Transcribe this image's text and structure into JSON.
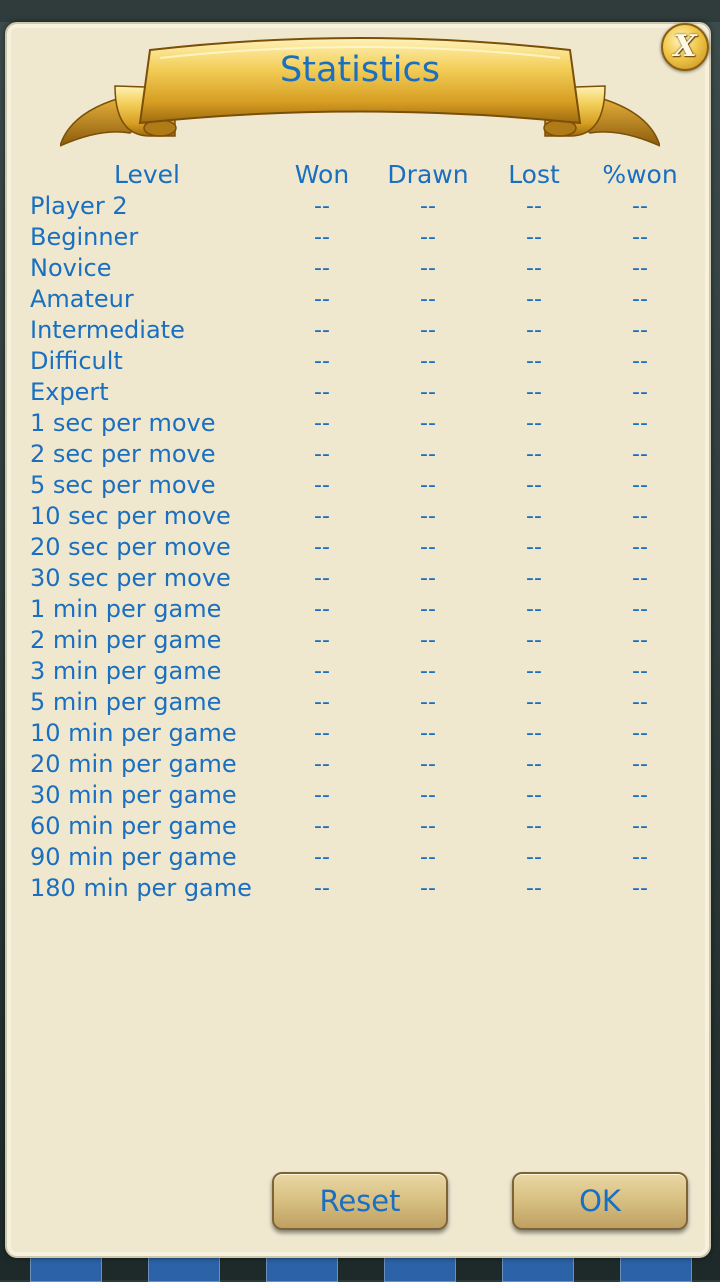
{
  "dialog": {
    "title": "Statistics",
    "close_label": "X"
  },
  "table": {
    "headers": {
      "level": "Level",
      "won": "Won",
      "drawn": "Drawn",
      "lost": "Lost",
      "pct_won": "%won"
    },
    "rows": [
      {
        "level": "Player 2",
        "won": "--",
        "drawn": "--",
        "lost": "--",
        "pct": "--"
      },
      {
        "level": "Beginner",
        "won": "--",
        "drawn": "--",
        "lost": "--",
        "pct": "--"
      },
      {
        "level": "Novice",
        "won": "--",
        "drawn": "--",
        "lost": "--",
        "pct": "--"
      },
      {
        "level": "Amateur",
        "won": "--",
        "drawn": "--",
        "lost": "--",
        "pct": "--"
      },
      {
        "level": "Intermediate",
        "won": "--",
        "drawn": "--",
        "lost": "--",
        "pct": "--"
      },
      {
        "level": "Difficult",
        "won": "--",
        "drawn": "--",
        "lost": "--",
        "pct": "--"
      },
      {
        "level": "Expert",
        "won": "--",
        "drawn": "--",
        "lost": "--",
        "pct": "--"
      },
      {
        "level": "1 sec per move",
        "won": "--",
        "drawn": "--",
        "lost": "--",
        "pct": "--"
      },
      {
        "level": "2 sec per move",
        "won": "--",
        "drawn": "--",
        "lost": "--",
        "pct": "--"
      },
      {
        "level": "5 sec per move",
        "won": "--",
        "drawn": "--",
        "lost": "--",
        "pct": "--"
      },
      {
        "level": "10 sec per move",
        "won": "--",
        "drawn": "--",
        "lost": "--",
        "pct": "--"
      },
      {
        "level": "20 sec per move",
        "won": "--",
        "drawn": "--",
        "lost": "--",
        "pct": "--"
      },
      {
        "level": "30 sec per move",
        "won": "--",
        "drawn": "--",
        "lost": "--",
        "pct": "--"
      },
      {
        "level": "1 min per game",
        "won": "--",
        "drawn": "--",
        "lost": "--",
        "pct": "--"
      },
      {
        "level": "2 min per game",
        "won": "--",
        "drawn": "--",
        "lost": "--",
        "pct": "--"
      },
      {
        "level": "3 min per game",
        "won": "--",
        "drawn": "--",
        "lost": "--",
        "pct": "--"
      },
      {
        "level": "5 min per game",
        "won": "--",
        "drawn": "--",
        "lost": "--",
        "pct": "--"
      },
      {
        "level": "10 min per game",
        "won": "--",
        "drawn": "--",
        "lost": "--",
        "pct": "--"
      },
      {
        "level": "20 min per game",
        "won": "--",
        "drawn": "--",
        "lost": "--",
        "pct": "--"
      },
      {
        "level": "30 min per game",
        "won": "--",
        "drawn": "--",
        "lost": "--",
        "pct": "--"
      },
      {
        "level": "60 min per game",
        "won": "--",
        "drawn": "--",
        "lost": "--",
        "pct": "--"
      },
      {
        "level": "90 min per game",
        "won": "--",
        "drawn": "--",
        "lost": "--",
        "pct": "--"
      },
      {
        "level": "180 min per game",
        "won": "--",
        "drawn": "--",
        "lost": "--",
        "pct": "--"
      }
    ]
  },
  "buttons": {
    "reset": "Reset",
    "ok": "OK"
  },
  "colors": {
    "text": "#1a6fc0",
    "panel": "#efe8cf",
    "ribbon": "#e8b83a"
  },
  "icons": {
    "close": "close-icon",
    "banner": "ribbon-banner"
  }
}
